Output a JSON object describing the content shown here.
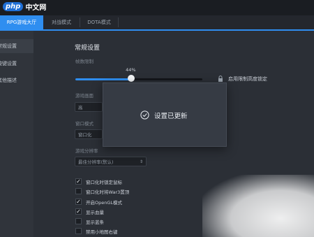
{
  "logo": {
    "badge": "php",
    "text": "中文网"
  },
  "tabs": [
    {
      "label": "RPG游戏大厅",
      "active": true
    },
    {
      "label": "对战模式",
      "active": false
    },
    {
      "label": "DOTA模式",
      "active": false
    }
  ],
  "sidebar": {
    "items": [
      {
        "label": "常规设置",
        "active": true
      },
      {
        "label": "按键设置",
        "active": false
      },
      {
        "label": "其他描述",
        "active": false
      }
    ]
  },
  "main": {
    "heading": "常规设置",
    "fps_label": "帧数限制",
    "slider": {
      "value_text": "44%",
      "fraction": 0.44
    },
    "lock_label": "启用限制高度锁定",
    "labels": [
      "游戏画面",
      "窗口模式",
      "游戏分辨率"
    ],
    "selects": [
      {
        "value": "高"
      },
      {
        "value": "窗口化"
      },
      {
        "value": "最佳分辨率(默认)"
      }
    ],
    "checkboxes": [
      {
        "label": "窗口化时锁定鼠标",
        "checked": true
      },
      {
        "label": "窗口化时将War3置顶",
        "checked": false
      },
      {
        "label": "开启OpenGL模式",
        "checked": true
      },
      {
        "label": "显示血量",
        "checked": true
      },
      {
        "label": "显示蓝条",
        "checked": false
      },
      {
        "label": "禁用小地图右键",
        "checked": false
      }
    ]
  },
  "toast": {
    "icon": "check-circle-icon",
    "text": "设置已更新"
  },
  "colors": {
    "accent": "#2f8ef0",
    "background": "#2b2f36",
    "sidebar": "#30343b"
  }
}
